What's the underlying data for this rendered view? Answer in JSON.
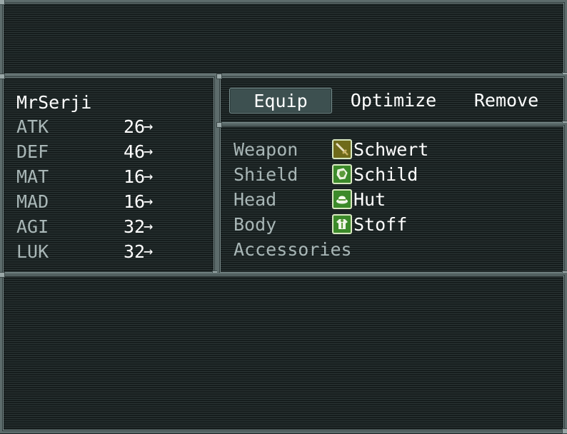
{
  "help": {
    "text": ""
  },
  "actor": {
    "name": "MrSerji"
  },
  "stats": [
    {
      "label": "ATK",
      "value": "26",
      "arrow": "→"
    },
    {
      "label": "DEF",
      "value": "46",
      "arrow": "→"
    },
    {
      "label": "MAT",
      "value": "16",
      "arrow": "→"
    },
    {
      "label": "MAD",
      "value": "16",
      "arrow": "→"
    },
    {
      "label": "AGI",
      "value": "32",
      "arrow": "→"
    },
    {
      "label": "LUK",
      "value": "32",
      "arrow": "→"
    }
  ],
  "commands": [
    {
      "label": "Equip",
      "selected": true
    },
    {
      "label": "Optimize",
      "selected": false
    },
    {
      "label": "Remove",
      "selected": false
    }
  ],
  "slots": [
    {
      "label": "Weapon",
      "item": "Schwert",
      "icon": "sword-icon",
      "icon_color": "#6f6a1a"
    },
    {
      "label": "Shield",
      "item": "Schild",
      "icon": "shield-icon",
      "icon_color": "#3c8a2a"
    },
    {
      "label": "Head",
      "item": "Hut",
      "icon": "hat-icon",
      "icon_color": "#3c8a2a"
    },
    {
      "label": "Body",
      "item": "Stoff",
      "icon": "cloth-armor-icon",
      "icon_color": "#3c8a2a"
    },
    {
      "label": "Accessories",
      "item": "",
      "icon": "",
      "icon_color": ""
    }
  ],
  "colors": {
    "system_text": "#a8b6b6",
    "normal_text": "#ffffff",
    "window_border": "#5d6c6c"
  }
}
